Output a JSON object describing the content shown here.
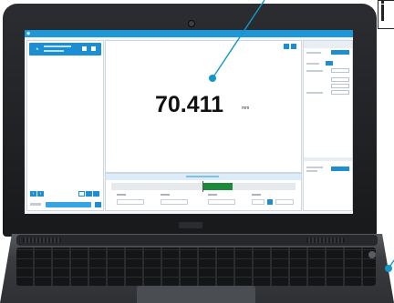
{
  "app": {
    "title": ""
  },
  "measurement": {
    "value": "70.411",
    "unit": "mm"
  },
  "tolerance_bar": {
    "fill_from_fraction": 0.5,
    "fill_to_fraction": 0.66
  },
  "colors": {
    "accent": "#1c8ed3",
    "callout": "#1597c9",
    "bar_fill": "#1b8a3a",
    "titlebar": "#1e97d8"
  },
  "icons": {
    "app": "app-logo-icon",
    "device": "gauge-device-icon"
  }
}
